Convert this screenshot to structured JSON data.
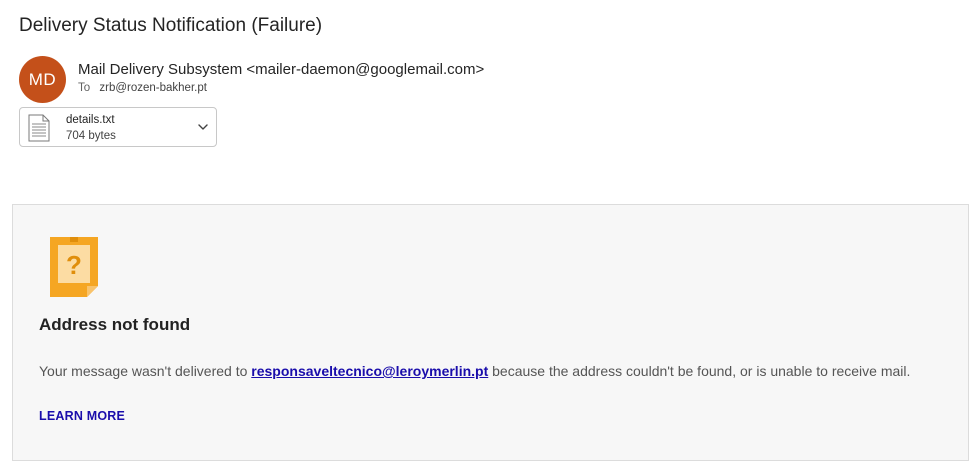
{
  "email": {
    "subject": "Delivery Status Notification (Failure)",
    "sender": {
      "initials": "MD",
      "display": "Mail Delivery Subsystem <mailer-daemon@googlemail.com>",
      "avatar_color": "#c4501a"
    },
    "to_label": "To",
    "to_address": "zrb@rozen-bakher.pt",
    "attachment": {
      "name": "details.txt",
      "size": "704 bytes",
      "icon": "text-file-icon"
    }
  },
  "notice": {
    "icon": "sticky-note-question-icon",
    "title": "Address not found",
    "body_prefix": "Your message wasn't delivered to ",
    "address": "responsaveltecnico@leroymerlin.pt",
    "body_suffix": " because the address couldn't be found, or is unable to receive mail.",
    "learn_more": "LEARN MORE",
    "link_color": "#1a0dab",
    "note_color": "#f5a623"
  }
}
